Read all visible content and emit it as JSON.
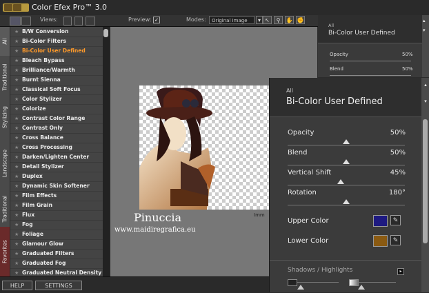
{
  "app": {
    "title": "Color Efex Pro™ 3.0"
  },
  "toolbar": {
    "views_label": "Views:",
    "preview_label": "Preview:",
    "preview_checked": true,
    "modes_label": "Modes:",
    "modes_value": "Original Image"
  },
  "tabs": [
    "All",
    "Traditional",
    "Stylizing",
    "Landscape",
    "Traditional",
    "Favorites"
  ],
  "filters": [
    {
      "label": "B/W Conversion"
    },
    {
      "label": "Bi-Color Filters"
    },
    {
      "label": "Bi-Color User Defined",
      "active": true
    },
    {
      "label": "Bleach Bypass"
    },
    {
      "label": "Brilliance/Warmth"
    },
    {
      "label": "Burnt Sienna"
    },
    {
      "label": "Classical Soft Focus"
    },
    {
      "label": "Color Stylizer"
    },
    {
      "label": "Colorize"
    },
    {
      "label": "Contrast Color Range"
    },
    {
      "label": "Contrast Only"
    },
    {
      "label": "Cross Balance"
    },
    {
      "label": "Cross Processing"
    },
    {
      "label": "Darken/Lighten Center"
    },
    {
      "label": "Detail Stylizer"
    },
    {
      "label": "Duplex"
    },
    {
      "label": "Dynamic Skin Softener"
    },
    {
      "label": "Film Effects"
    },
    {
      "label": "Film Grain"
    },
    {
      "label": "Flux"
    },
    {
      "label": "Fog"
    },
    {
      "label": "Foliage"
    },
    {
      "label": "Glamour Glow"
    },
    {
      "label": "Graduated Filters"
    },
    {
      "label": "Graduated Fog"
    },
    {
      "label": "Graduated Neutral Density"
    }
  ],
  "preview": {
    "caption_name": "Pinuccia",
    "caption_url": "www.maidiregrafica.eu",
    "caption_small": "Imm"
  },
  "panel_bg": {
    "category": "All",
    "title": "Bi-Color User Defined",
    "params": [
      {
        "label": "Opacity",
        "value": "50%"
      },
      {
        "label": "Blend",
        "value": "50%"
      }
    ]
  },
  "panel": {
    "category": "All",
    "title": "Bi-Color User Defined",
    "params": [
      {
        "label": "Opacity",
        "value": "50%",
        "level": 0.5
      },
      {
        "label": "Blend",
        "value": "50%",
        "level": 0.5
      },
      {
        "label": "Vertical Shift",
        "value": "45%",
        "level": 0.45
      },
      {
        "label": "Rotation",
        "value": "180°",
        "level": 0.5
      }
    ],
    "upper_color_label": "Upper Color",
    "upper_color": "#1e1a80",
    "lower_color_label": "Lower Color",
    "lower_color": "#8a5a12",
    "shadows_label": "Shadows / Highlights"
  },
  "bottom": {
    "help": "HELP",
    "settings": "SETTINGS"
  }
}
